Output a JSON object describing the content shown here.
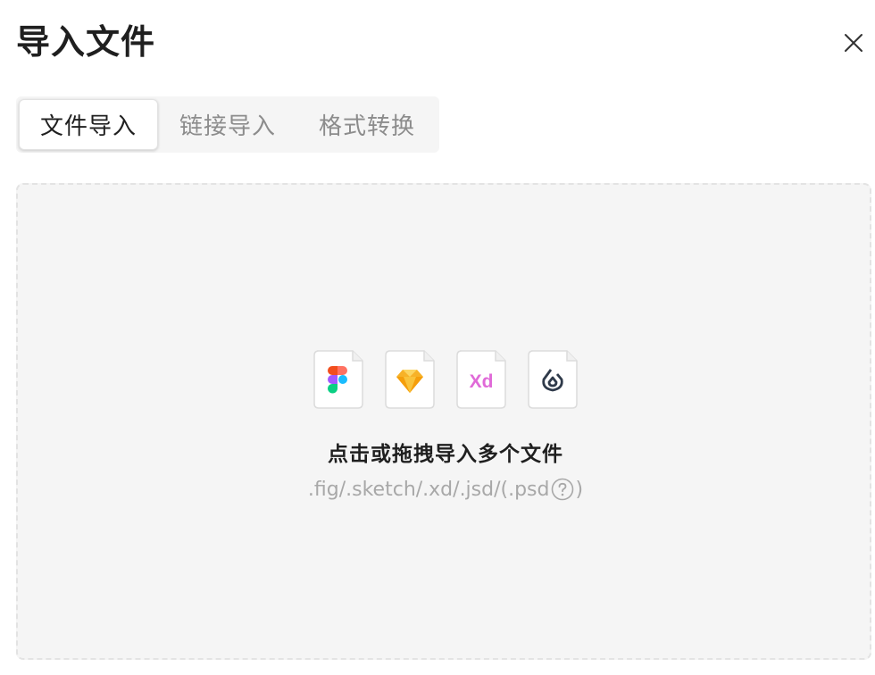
{
  "dialog": {
    "title": "导入文件",
    "close_icon": "close-icon"
  },
  "tabs": [
    {
      "label": "文件导入",
      "active": true
    },
    {
      "label": "链接导入",
      "active": false
    },
    {
      "label": "格式转换",
      "active": false
    }
  ],
  "dropzone": {
    "file_types": [
      {
        "icon": "figma-file-icon",
        "label": ""
      },
      {
        "icon": "sketch-file-icon",
        "label": ""
      },
      {
        "icon": "xd-file-icon",
        "label": "Xd"
      },
      {
        "icon": "jsd-file-icon",
        "label": ""
      }
    ],
    "prompt": "点击或拖拽导入多个文件",
    "formats_before": ".fig/.sketch/.xd/.jsd/(.psd",
    "help_icon": "question-circle-icon",
    "formats_after": ")"
  },
  "colors": {
    "accent_text": "#1f1f1f",
    "muted_text": "#8c8c8c",
    "dropzone_bg": "#f5f5f5",
    "xd_pink": "#e06ad8",
    "sketch_orange": "#f7b228"
  }
}
